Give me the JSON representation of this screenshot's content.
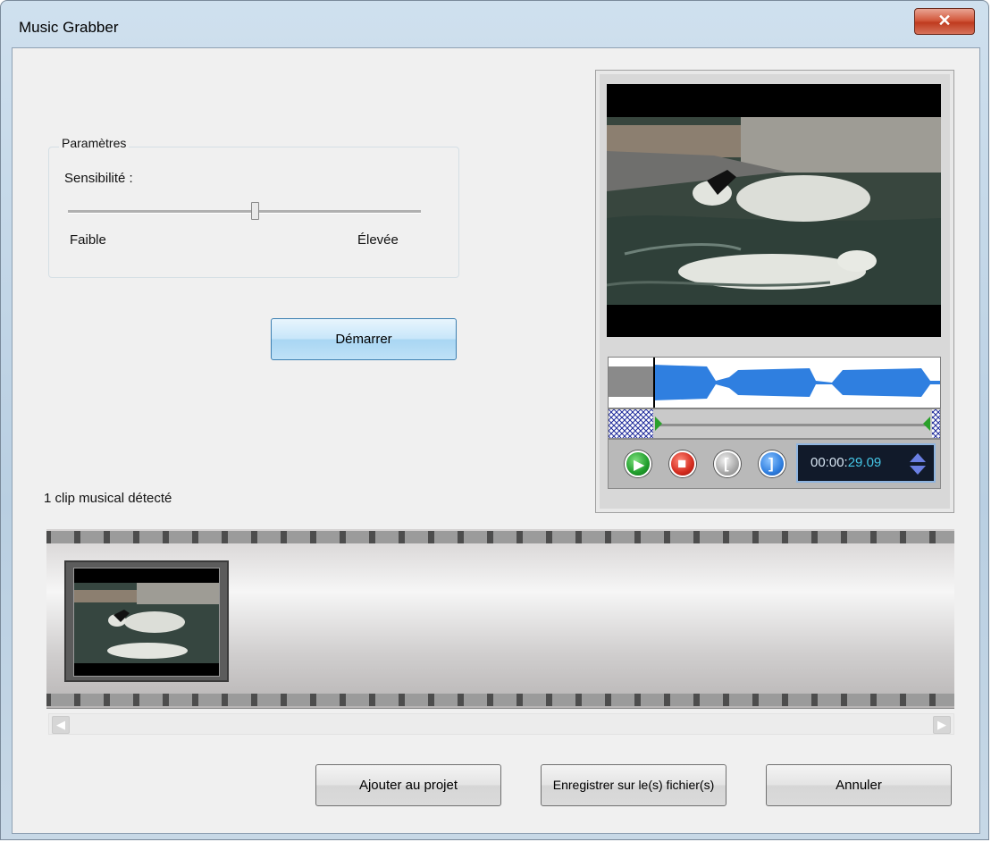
{
  "window": {
    "title": "Music Grabber",
    "close_glyph": "✕"
  },
  "parameters": {
    "legend": "Paramètres",
    "sensitivity_label": "Sensibilité :",
    "low_label": "Faible",
    "high_label": "Élevée",
    "sensitivity_value": 0.53
  },
  "start_button": "Démarrer",
  "clips_detected": "1 clip musical détecté",
  "player": {
    "timecode_prefix": "00:00:",
    "timecode_suffix": "29.09",
    "play_icon": "play-icon",
    "stop_icon": "stop-icon",
    "mark_in_icon": "mark-in-icon",
    "mark_out_icon": "mark-out-icon",
    "play_glyph": "▶",
    "stop_glyph": "■",
    "mark_in_glyph": "[",
    "mark_out_glyph": "]"
  },
  "scroll": {
    "left_glyph": "◀",
    "right_glyph": "▶"
  },
  "buttons": {
    "add": "Ajouter au projet",
    "save": "Enregistrer sur le(s) fichier(s)",
    "cancel": "Annuler"
  },
  "colors": {
    "accent_blue": "#2f7fe0",
    "play_green": "#1f9d2b",
    "stop_red": "#d42b1e"
  }
}
